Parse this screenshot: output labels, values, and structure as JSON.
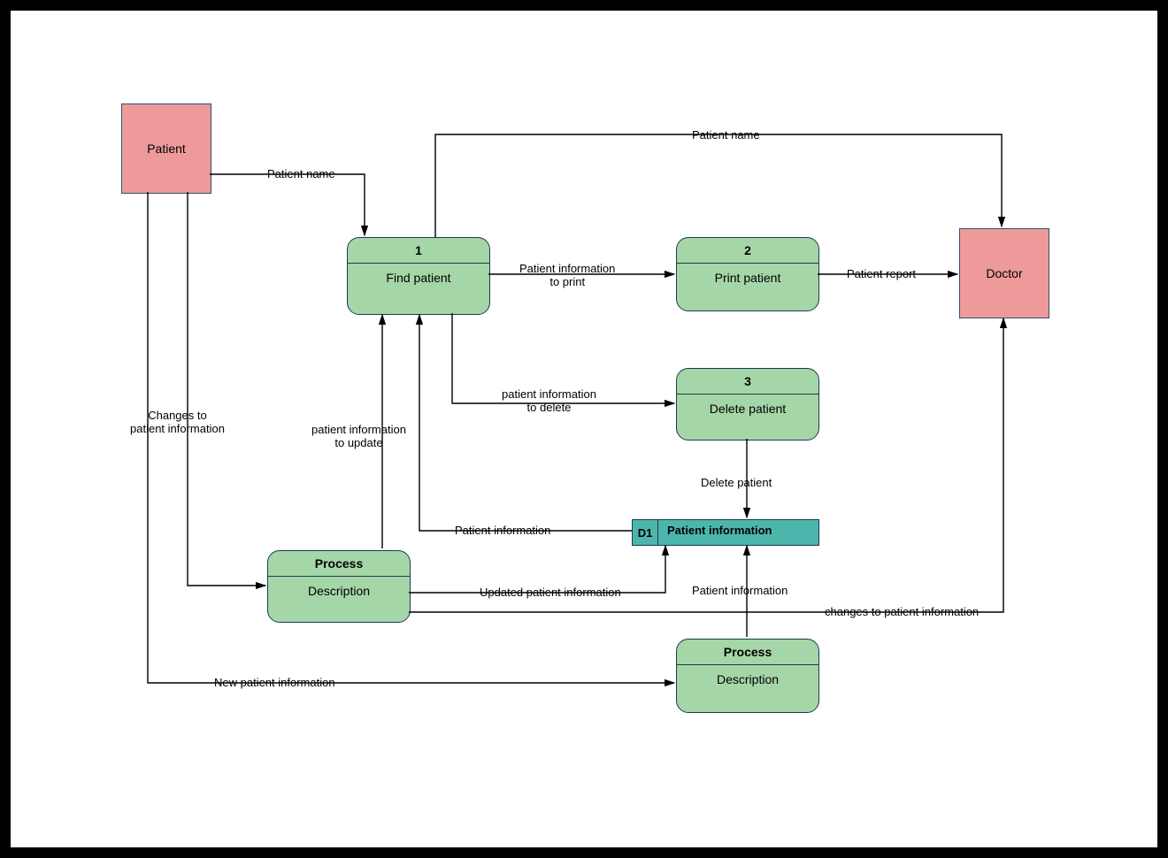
{
  "entities": {
    "patient": "Patient",
    "doctor": "Doctor"
  },
  "processes": {
    "p1": {
      "header": "1",
      "body": "Find patient"
    },
    "p2": {
      "header": "2",
      "body": "Print patient"
    },
    "p3": {
      "header": "3",
      "body": "Delete patient"
    },
    "p4": {
      "header": "Process",
      "body": "Description"
    },
    "p5": {
      "header": "Process",
      "body": "Description"
    }
  },
  "datastore": {
    "id": "D1",
    "label": "Patient information"
  },
  "flows": {
    "f1": "Patient name",
    "f2": "Patient name",
    "f3": "Patient information\nto print",
    "f4": "Patient report",
    "f5": "patient information\nto delete",
    "f6": "Delete patient",
    "f7": "Patient information",
    "f8": "patient information\nto update",
    "f9": "Updated patient information",
    "f10": "Patient information",
    "f11": "changes to patient information",
    "f12": "Changes to\npatient information",
    "f13": "New patient information"
  }
}
